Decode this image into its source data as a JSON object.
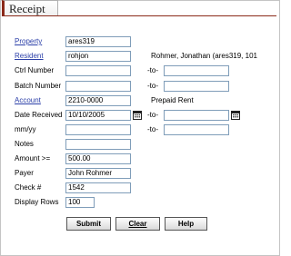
{
  "tab": {
    "title": "Receipt"
  },
  "form": {
    "property": {
      "label": "Property",
      "value": "ares319"
    },
    "resident": {
      "label": "Resident",
      "value": "rohjon",
      "info": "Rohmer, Jonathan  (ares319, 101"
    },
    "ctrl_number": {
      "label": "Ctrl Number",
      "value": "",
      "to_label": "-to-",
      "to_value": ""
    },
    "batch_number": {
      "label": "Batch Number",
      "value": "",
      "to_label": "-to-",
      "to_value": ""
    },
    "account": {
      "label": "Account",
      "value": "2210-0000",
      "info": "Prepaid Rent"
    },
    "date_received": {
      "label": "Date Received",
      "value": "10/10/2005",
      "to_label": "-to-",
      "to_value": ""
    },
    "mmyy": {
      "label": "mm/yy",
      "value": "",
      "to_label": "-to-",
      "to_value": ""
    },
    "notes": {
      "label": "Notes",
      "value": ""
    },
    "amount": {
      "label": "Amount >=",
      "value": "500.00"
    },
    "payer": {
      "label": "Payer",
      "value": "John Rohmer"
    },
    "check": {
      "label": "Check #",
      "value": "1542"
    },
    "display_rows": {
      "label": "Display Rows",
      "value": "100"
    }
  },
  "buttons": {
    "submit": "Submit",
    "clear": "Clear",
    "help": "Help"
  },
  "icons": {
    "calendar": "calendar-icon"
  }
}
